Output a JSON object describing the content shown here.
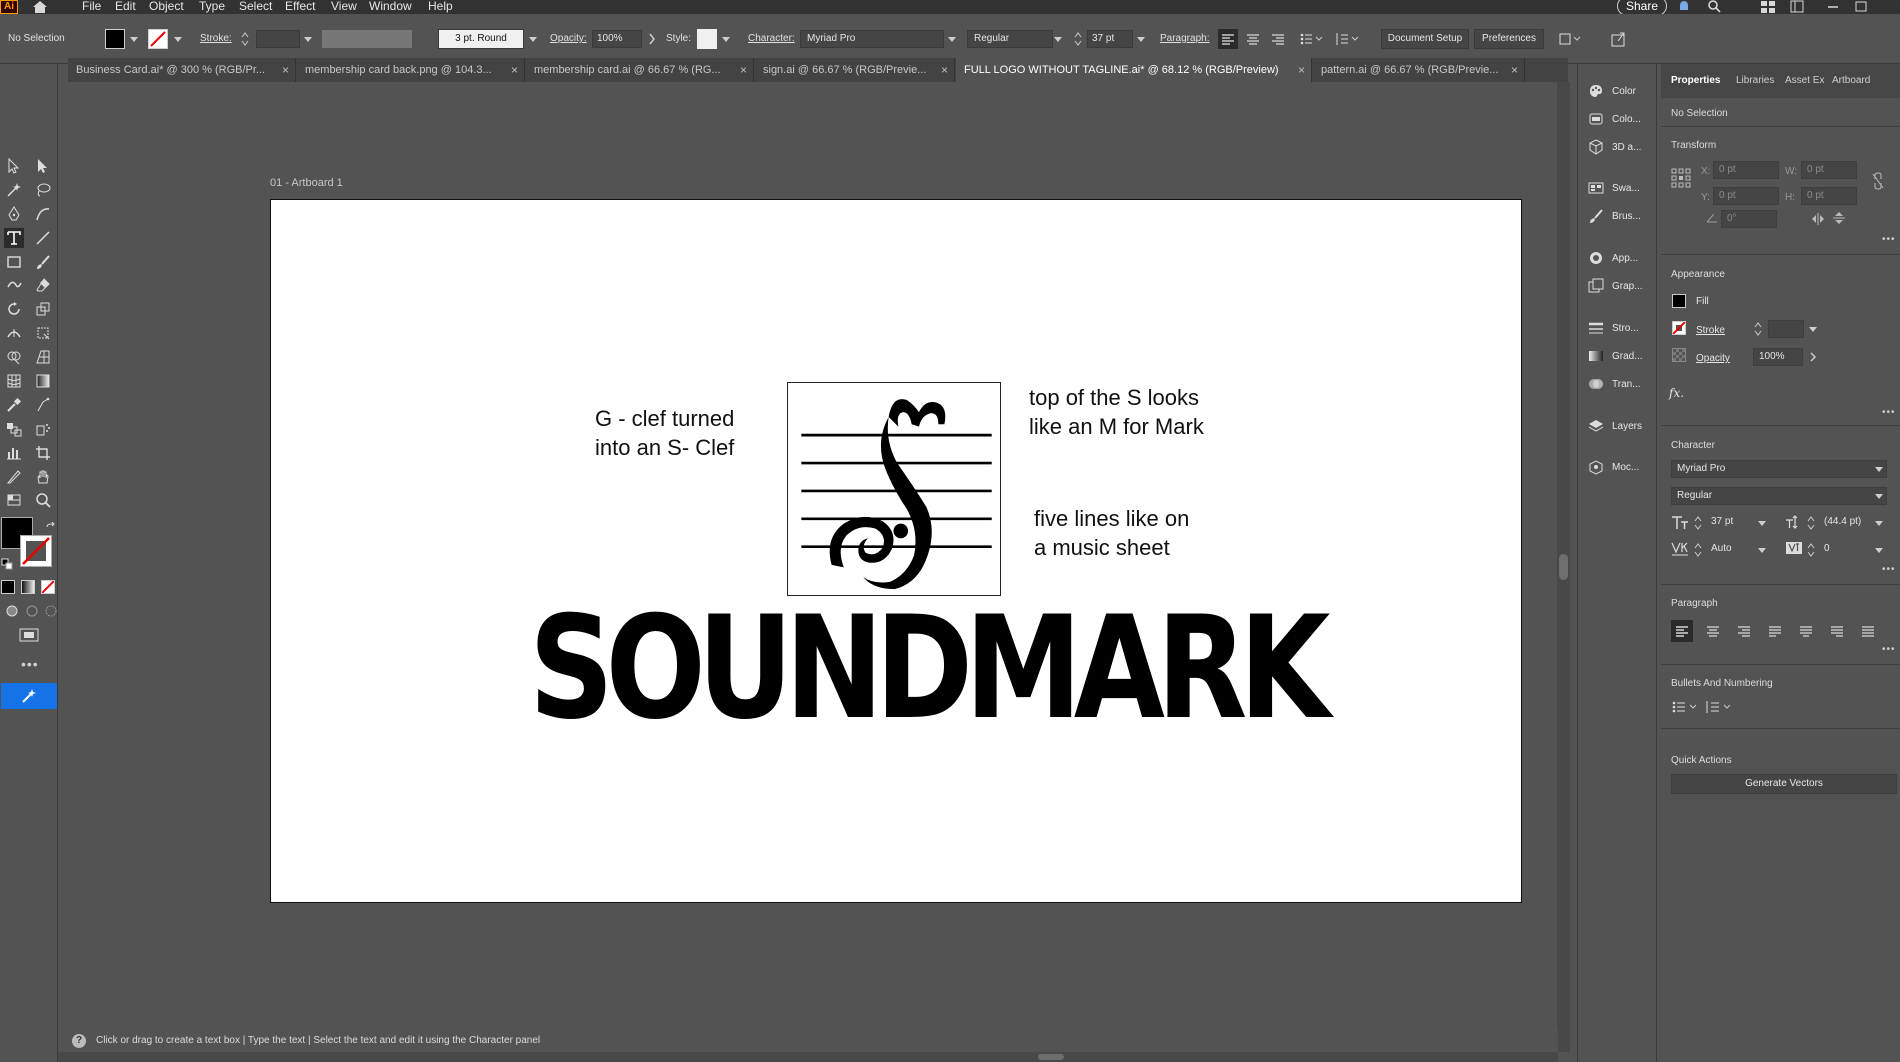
{
  "app": {
    "logo": "Ai",
    "menu": [
      "File",
      "Edit",
      "Object",
      "Type",
      "Select",
      "Effect",
      "View",
      "Window",
      "Help"
    ],
    "share_label": "Share"
  },
  "control_bar": {
    "selection": "No Selection",
    "stroke_label": "Stroke:",
    "stroke_profile": "3 pt. Round",
    "opacity_label": "Opacity:",
    "opacity_value": "100%",
    "style_label": "Style:",
    "character_label": "Character:",
    "font_family": "Myriad Pro",
    "font_style": "Regular",
    "font_size": "37 pt",
    "paragraph_label": "Paragraph:",
    "document_setup": "Document Setup",
    "preferences": "Preferences"
  },
  "tabs": [
    {
      "label": "Business Card.ai* @ 300 % (RGB/Pr..."
    },
    {
      "label": "membership card back.png @ 104.3..."
    },
    {
      "label": "membership card.ai @ 66.67 % (RG..."
    },
    {
      "label": "sign.ai @ 66.67 % (RGB/Previe..."
    },
    {
      "label": "FULL LOGO WITHOUT TAGLINE.ai* @ 68.12 % (RGB/Preview)"
    },
    {
      "label": "pattern.ai @ 66.67 % (RGB/Previe..."
    }
  ],
  "tab_close_glyph": "×",
  "artboard": {
    "label": "01 - Artboard 1",
    "note_left_1": "G - clef turned",
    "note_left_2": "into an S- Clef",
    "note_topright_1": "top of the S looks",
    "note_topright_2": "like an M for Mark",
    "note_bottomright_1": "five lines like on",
    "note_bottomright_2": "a music sheet",
    "wordmark": "SOUNDMARK"
  },
  "status_bar": {
    "help_glyph": "?",
    "hint": "Click or drag to create a text box  |  Type the text  |  Select the text and edit it using the Character panel"
  },
  "dock": [
    {
      "label": "Color",
      "icon": "color-palette-icon"
    },
    {
      "label": "Colo...",
      "icon": "color-guide-icon"
    },
    {
      "label": "3D a...",
      "icon": "cube-icon"
    },
    {
      "label": "Swa...",
      "icon": "swatches-icon"
    },
    {
      "label": "Brus...",
      "icon": "brush-icon"
    },
    {
      "label": "App...",
      "icon": "appearance-icon"
    },
    {
      "label": "Grap...",
      "icon": "graphic-styles-icon"
    },
    {
      "label": "Stro...",
      "icon": "stroke-icon"
    },
    {
      "label": "Grad...",
      "icon": "gradient-icon"
    },
    {
      "label": "Tran...",
      "icon": "transparency-icon"
    },
    {
      "label": "Layers",
      "icon": "layers-icon"
    },
    {
      "label": "Moc...",
      "icon": "mockup-icon"
    }
  ],
  "properties": {
    "tabs": [
      "Properties",
      "Libraries",
      "Asset Ex",
      "Artboard"
    ],
    "selection": "No Selection",
    "transform": {
      "title": "Transform",
      "x_label": "X:",
      "x_value": "0 pt",
      "y_label": "Y:",
      "y_value": "0 pt",
      "w_label": "W:",
      "w_value": "0 pt",
      "h_label": "H:",
      "h_value": "0 pt",
      "angle_value": "0°"
    },
    "appearance": {
      "title": "Appearance",
      "fill_label": "Fill",
      "stroke_label": "Stroke",
      "opacity_label": "Opacity",
      "opacity_value": "100%",
      "fx_label": "fx."
    },
    "character": {
      "title": "Character",
      "font_family": "Myriad Pro",
      "font_style": "Regular",
      "size": "37 pt",
      "leading": "(44.4 pt)",
      "kerning": "Auto",
      "tracking": "0"
    },
    "paragraph": {
      "title": "Paragraph"
    },
    "bullets": {
      "title": "Bullets And Numbering"
    },
    "quick_actions": {
      "title": "Quick Actions",
      "generate_vectors": "Generate Vectors"
    }
  },
  "more_glyph": "•••",
  "colors": {
    "ui_bg": "#535353",
    "menu_bg": "#323232",
    "accent_blue": "#1473e6",
    "fill_color": "#000000",
    "artboard_bg": "#ffffff"
  }
}
